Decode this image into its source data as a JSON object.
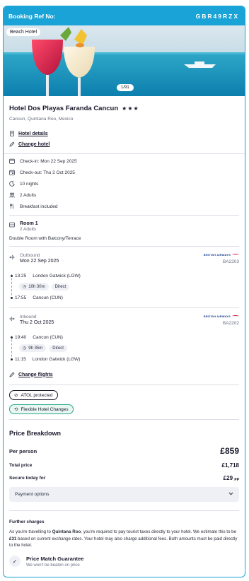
{
  "booking": {
    "ref_label": "Booking Ref No:",
    "ref_value": "GBR49RZX"
  },
  "hero": {
    "badge": "Beach Hotel",
    "counter": "1/91"
  },
  "hotel": {
    "name": "Hotel Dos Playas Faranda Cancun",
    "stars": "★★★",
    "location": "Cancun, Quintana Roo, Mexico",
    "details_link": "Hotel details",
    "change_link": "Change hotel"
  },
  "stay": {
    "checkin": "Check-in: Mon 22 Sep 2025",
    "checkout": "Check-out: Thu 2 Oct 2025",
    "nights": "10 nights",
    "adults": "2 Adults",
    "board": "Breakfast included"
  },
  "room": {
    "title": "Room 1",
    "occupancy": "2 Adults",
    "type": "Double Room with Balcony/Terrace"
  },
  "outbound": {
    "direction": "Outbound",
    "date": "Mon 22 Sep 2025",
    "airline_logo": "BRITISH AIRWAYS",
    "code": "BA2203",
    "depart_time": "13:25",
    "depart_airport": "London Gatwick (LGW)",
    "duration": "10h 30m",
    "stops": "Direct",
    "arrive_time": "17:55",
    "arrive_airport": "Cancun (CUN)"
  },
  "inbound": {
    "direction": "Inbound",
    "date": "Thu 2 Oct 2025",
    "airline_logo": "BRITISH AIRWAYS",
    "code": "BA2202",
    "depart_time": "19:40",
    "depart_airport": "Cancun (CUN)",
    "duration": "9h 35m",
    "stops": "Direct",
    "arrive_time": "11:15",
    "arrive_airport": "London Gatwick (LGW)"
  },
  "change_flights": "Change flights",
  "badges": {
    "atol": "ATOL protected",
    "flexible": "Flexible Hotel Changes"
  },
  "price": {
    "title": "Price Breakdown",
    "per_person_label": "Per person",
    "per_person_value": "£859",
    "total_label": "Total price",
    "total_value": "£1,718",
    "secure_label": "Secure today for",
    "secure_value": "£29",
    "secure_suffix": "pp",
    "payment_options": "Payment options"
  },
  "further": {
    "title": "Further charges",
    "text_1": "As you're travelling to ",
    "place": "Quintana Roo",
    "text_2": ", you're required to pay tourist taxes directly to your hotel. We estimate this to be ",
    "amount": "£31",
    "text_3": " based on current exchange rates. Your hotel may also charge additional fees. Both amounts must be paid directly to the hotel."
  },
  "guarantee": {
    "title": "Price Match Guarantee",
    "subtitle": "We won't be beaten on price"
  },
  "colors": {
    "brand": "#1aa3d6",
    "flex_green": "#2aa58a"
  }
}
